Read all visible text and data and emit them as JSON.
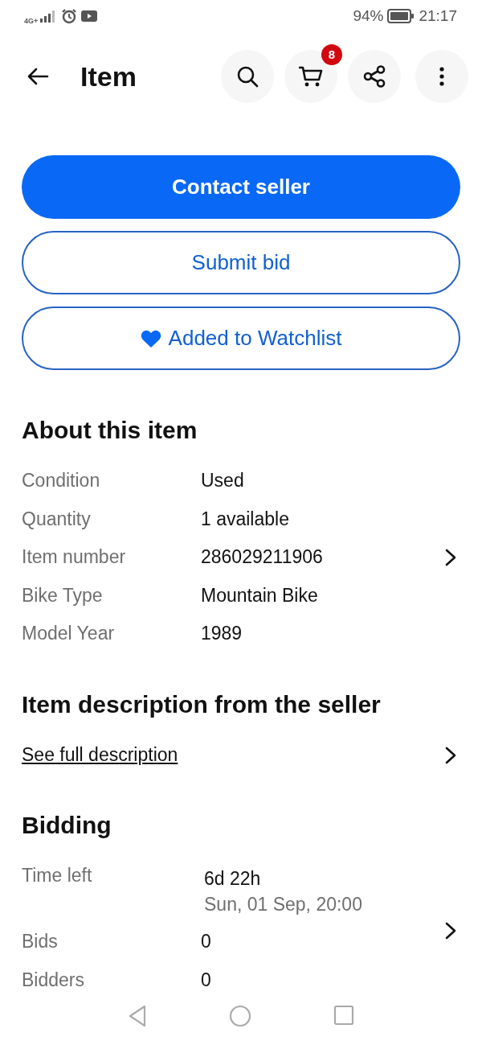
{
  "status_bar": {
    "network": "4G+",
    "battery": "94%",
    "time": "21:17"
  },
  "top_bar": {
    "title": "Item",
    "cart_count": "8"
  },
  "actions": [
    {
      "label": "Contact seller",
      "kind": "primary"
    },
    {
      "label": "Submit bid",
      "kind": "outline"
    },
    {
      "label": "Added to Watchlist",
      "kind": "outline",
      "watched": true
    }
  ],
  "about": {
    "heading": "About this item",
    "rows": [
      {
        "label": "Condition",
        "value": "Used",
        "kind": "plain"
      },
      {
        "label": "Quantity",
        "value": "1 available",
        "kind": "plain"
      },
      {
        "label": "Item number",
        "value": "286029211906",
        "kind": "link"
      },
      {
        "label": "Bike Type",
        "value": "Mountain Bike",
        "kind": "plain"
      },
      {
        "label": "Model Year",
        "value": "1989",
        "kind": "plain"
      }
    ]
  },
  "description": {
    "heading": "Item description from the seller",
    "link": "See full description"
  },
  "bidding": {
    "heading": "Bidding",
    "kind": "link",
    "rows": [
      {
        "label": "Time left",
        "value": "6d 22h",
        "note": "Sun, 01 Sep, 20:00"
      },
      {
        "label": "Bids",
        "value": "0"
      },
      {
        "label": "Bidders",
        "value": "0"
      }
    ]
  }
}
